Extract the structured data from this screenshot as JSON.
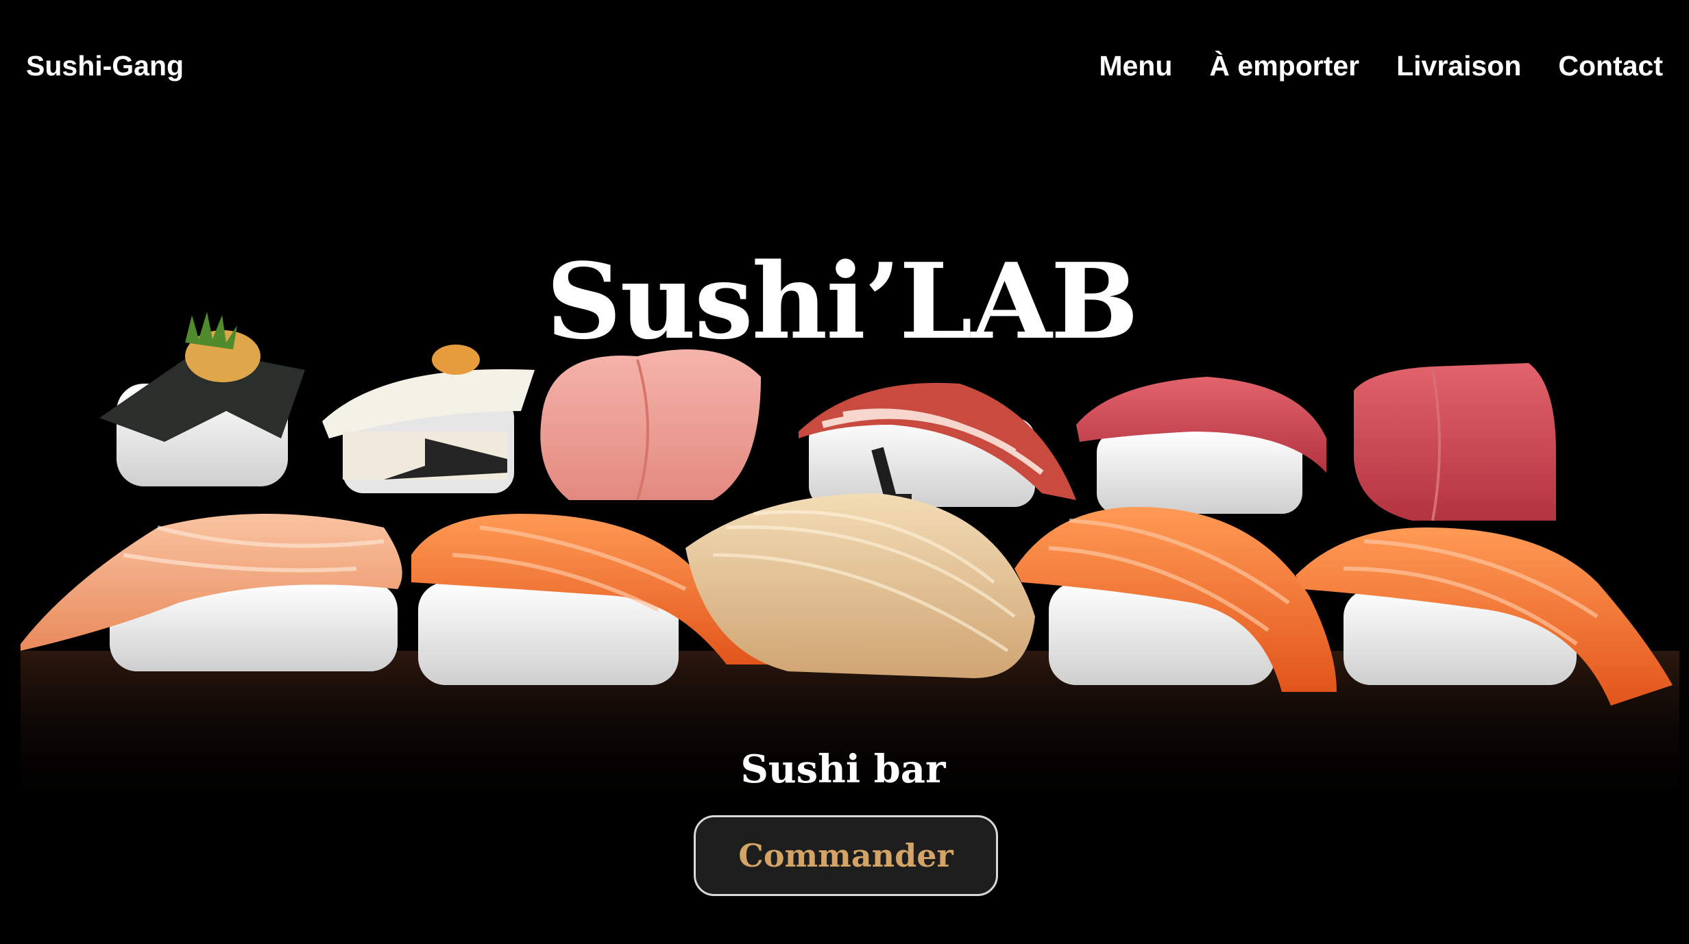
{
  "header": {
    "brand": "Sushi-Gang",
    "nav": [
      {
        "label": "Menu"
      },
      {
        "label": "À emporter"
      },
      {
        "label": "Livraison"
      },
      {
        "label": "Contact"
      }
    ]
  },
  "hero": {
    "title": "Sushi’LAB",
    "subtitle": "Sushi bar",
    "cta_label": "Commander",
    "background_image": "photo of nigiri sushi pieces on black reflective surface"
  },
  "colors": {
    "background": "#000000",
    "text": "#ffffff",
    "cta_text": "#d4a466",
    "cta_background": "#1e1e1e",
    "cta_border": "#d9d9d9"
  }
}
